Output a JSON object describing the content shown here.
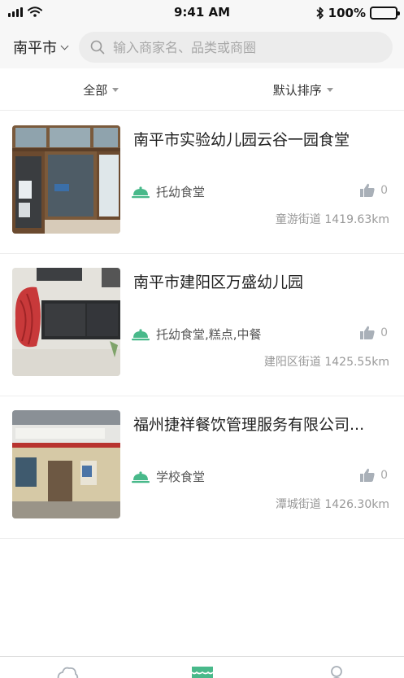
{
  "status_bar": {
    "time": "9:41 AM",
    "battery": "100%"
  },
  "header": {
    "city": "南平市",
    "search_placeholder": "输入商家名、品类或商圈"
  },
  "filters": [
    {
      "label": "全部"
    },
    {
      "label": "默认排序"
    }
  ],
  "merchants": [
    {
      "title": "南平市实验幼儿园云谷一园食堂",
      "category": "托幼食堂",
      "likes": "0",
      "location": "童游街道 1419.63km"
    },
    {
      "title": "南平市建阳区万盛幼儿园",
      "category": "托幼食堂,糕点,中餐",
      "likes": "0",
      "location": "建阳区街道 1425.55km"
    },
    {
      "title": "福州捷祥餐饮管理服务有限公司...",
      "category": "学校食堂",
      "likes": "0",
      "location": "潭城街道 1426.30km"
    }
  ],
  "colors": {
    "accent": "#48b98a",
    "icon_grey": "#a9b0b8"
  },
  "icons": [
    "signal-icon",
    "wifi-icon",
    "bluetooth-icon",
    "battery-icon",
    "chevron-down-icon",
    "search-icon",
    "dish-cover-icon",
    "thumbs-up-icon",
    "home-tab-icon",
    "store-tab-icon",
    "profile-tab-icon"
  ]
}
